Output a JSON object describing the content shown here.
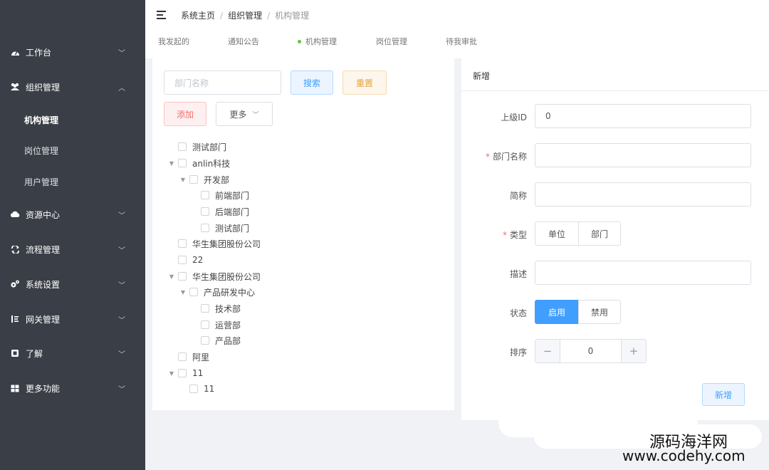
{
  "sidebar": {
    "menus": [
      {
        "label": "工作台",
        "icon": "dashboard-icon",
        "arrow": "down"
      },
      {
        "label": "组织管理",
        "icon": "users-icon",
        "arrow": "up"
      },
      {
        "label": "资源中心",
        "icon": "cloud-icon",
        "arrow": "down"
      },
      {
        "label": "流程管理",
        "icon": "flow-icon",
        "arrow": "down"
      },
      {
        "label": "系统设置",
        "icon": "gears-icon",
        "arrow": "down"
      },
      {
        "label": "网关管理",
        "icon": "gateway-icon",
        "arrow": "down"
      },
      {
        "label": "了解",
        "icon": "info-icon",
        "arrow": "down"
      },
      {
        "label": "更多功能",
        "icon": "grid-icon",
        "arrow": "down"
      }
    ],
    "submenu": [
      {
        "label": "机构管理",
        "active": true
      },
      {
        "label": "岗位管理",
        "active": false
      },
      {
        "label": "用户管理",
        "active": false
      }
    ]
  },
  "header": {
    "breadcrumb": [
      "系统主页",
      "组织管理",
      "机构管理"
    ],
    "tabs": [
      "我发起的",
      "通知公告",
      "机构管理",
      "岗位管理",
      "待我审批"
    ]
  },
  "toolbar": {
    "dept_placeholder": "部门名称",
    "search_label": "搜索",
    "reset_label": "重置",
    "add_label": "添加",
    "more_label": "更多"
  },
  "tree": [
    {
      "label": "测试部门"
    },
    {
      "label": "anlin科技"
    },
    {
      "label": "开发部"
    },
    {
      "label": "前端部门"
    },
    {
      "label": "后端部门"
    },
    {
      "label": "测试部门"
    },
    {
      "label": "华生集团股份公司"
    },
    {
      "label": "22"
    },
    {
      "label": "华生集团股份公司"
    },
    {
      "label": "产品研发中心"
    },
    {
      "label": "技术部"
    },
    {
      "label": "运营部"
    },
    {
      "label": "产品部"
    },
    {
      "label": "阿里"
    },
    {
      "label": "11"
    },
    {
      "label": "11"
    }
  ],
  "form": {
    "title": "新增",
    "parent_id_label": "上级ID",
    "parent_id_value": "0",
    "dept_name_label": "部门名称",
    "short_name_label": "简称",
    "type_label": "类型",
    "type_options": [
      "单位",
      "部门"
    ],
    "desc_label": "描述",
    "status_label": "状态",
    "status_options": [
      "启用",
      "禁用"
    ],
    "sort_label": "排序",
    "sort_value": "0",
    "submit_label": "新增"
  },
  "watermark": {
    "line1": "源码海洋网",
    "line2": "www.codehy.com"
  }
}
